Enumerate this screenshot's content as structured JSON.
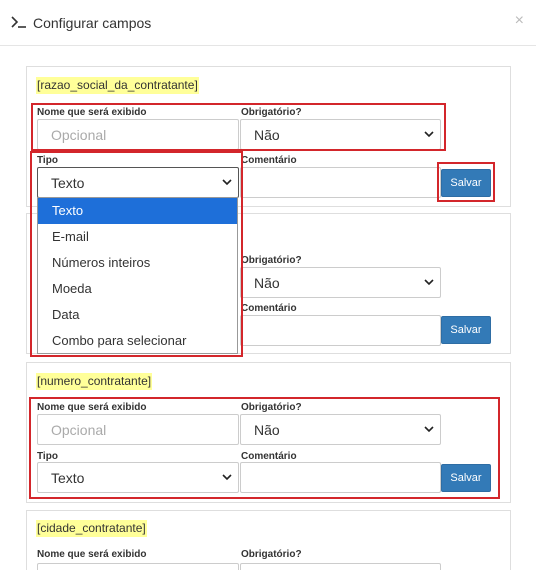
{
  "header": {
    "title": "Configurar campos",
    "close_glyph": "×"
  },
  "labels": {
    "nome": "Nome que será exibido",
    "obrigatorio": "Obrigatório?",
    "tipo": "Tipo",
    "comentario": "Comentário",
    "placeholder_nome": "Opcional",
    "salvar": "Salvar"
  },
  "cards": [
    {
      "tag": "[razao_social_da_contratante]",
      "obrigatorio": "Não",
      "tipo": "Texto"
    },
    {
      "tag": "",
      "obrigatorio": "Não",
      "tipo": "Texto"
    },
    {
      "tag": "[numero_contratante]",
      "obrigatorio": "Não",
      "tipo": "Texto"
    },
    {
      "tag": "[cidade_contratante]"
    }
  ],
  "dropdown": {
    "options": [
      "Texto",
      "E-mail",
      "Números inteiros",
      "Moeda",
      "Data",
      "Combo para selecionar"
    ],
    "selected_index": 0
  },
  "colors": {
    "accent": "#337ab7",
    "highlight": "#d3262b",
    "tag_bg": "#ffff99",
    "dropdown_active": "#1e6fd9"
  },
  "icons": {
    "header": "terminal-icon",
    "close": "close-icon",
    "select": "chevron-down-icon"
  }
}
